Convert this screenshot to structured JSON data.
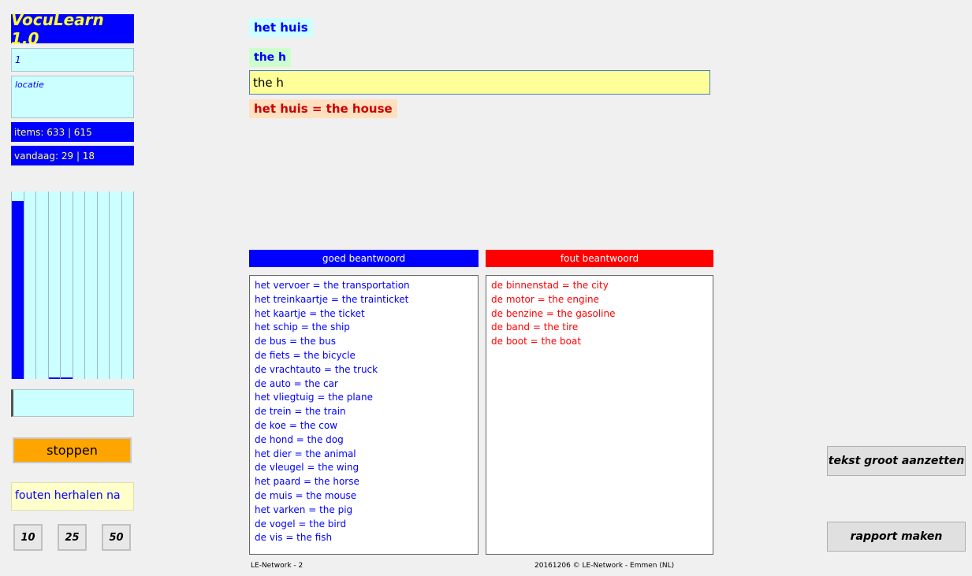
{
  "app": {
    "title": "VocuLearn 1.0",
    "lesson": "1",
    "location": "locatie",
    "items": "items: 633 | 615",
    "today": "vandaag: 29 | 18"
  },
  "progress_bars": [
    0.95,
    0.0,
    0.0,
    0.01,
    0.01,
    0.0,
    0.0,
    0.0,
    0.0,
    0.0
  ],
  "controls": {
    "stop_label": "stoppen",
    "repeat_label": "fouten herhalen na",
    "repeat_options": [
      "10",
      "25",
      "50"
    ],
    "large_text_label": "tekst groot aanzetten",
    "report_label": "rapport maken"
  },
  "quiz": {
    "word": "het huis",
    "typed_hint": "the h",
    "answer_value": "the h",
    "feedback": "het huis = the house"
  },
  "lists": {
    "good_header": "goed beantwoord",
    "bad_header": "fout beantwoord",
    "good": [
      "het vervoer = the transportation",
      "het treinkaartje = the trainticket",
      "het kaartje = the ticket",
      "het schip = the ship",
      "de bus = the bus",
      "de fiets = the bicycle",
      "de vrachtauto = the truck",
      "de auto = the car",
      "het vliegtuig = the plane",
      "de trein = the train",
      "de koe = the cow",
      "de hond = the dog",
      "het dier = the animal",
      "de vleugel = the wing",
      "het paard = the horse",
      "de muis = the mouse",
      "het varken = the pig",
      "de vogel = the bird",
      "de vis = the fish"
    ],
    "bad": [
      "de binnenstad = the city",
      "de motor = the engine",
      "de benzine = the gasoline",
      "de band = the tire",
      "de boot = the boat"
    ]
  },
  "footer": {
    "left": "LE-Network - 2",
    "right": "20161206 © LE-Network - Emmen (NL)"
  },
  "colors": {
    "accent_blue": "#0000ff",
    "error_red": "#ff0000",
    "stop_orange": "#ffa500",
    "cyan_bg": "#ccffff"
  }
}
